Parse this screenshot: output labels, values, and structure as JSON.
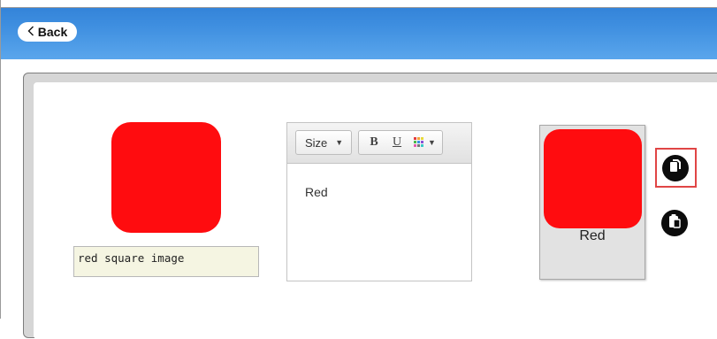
{
  "header": {
    "back_label": "Back"
  },
  "image_item": {
    "color": "#ff0c0f",
    "alt_text": "red square image"
  },
  "editor": {
    "size_label": "Size",
    "bold_label": "B",
    "underline_label": "U",
    "content": "Red"
  },
  "preview": {
    "color": "#ff0c0f",
    "label": "Red"
  },
  "actions": {
    "copy_icon": "copy-icon",
    "paste_icon": "paste-icon",
    "highlight_color": "#e04545"
  }
}
